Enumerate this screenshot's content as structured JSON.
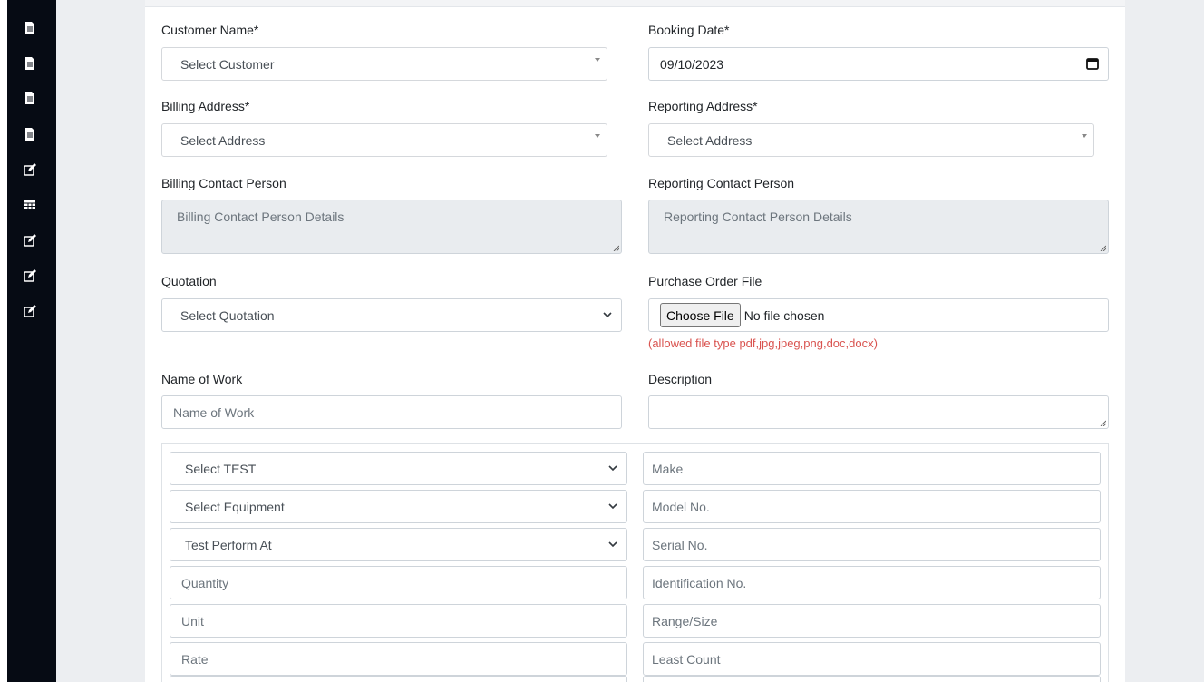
{
  "sidebar": {
    "icons": [
      "file-icon",
      "file-icon",
      "file-icon",
      "file-icon",
      "edit-icon",
      "table-icon",
      "edit-icon",
      "edit-icon",
      "edit-icon"
    ]
  },
  "form": {
    "customer_name": {
      "label": "Customer Name*",
      "value": "Select Customer"
    },
    "booking_date": {
      "label": "Booking Date*",
      "value": "09/10/2023"
    },
    "billing_address": {
      "label": "Billing Address*",
      "value": "Select Address"
    },
    "reporting_address": {
      "label": "Reporting Address*",
      "value": "Select Address"
    },
    "billing_contact": {
      "label": "Billing Contact Person",
      "value": "Billing Contact Person Details"
    },
    "reporting_contact": {
      "label": "Reporting Contact Person",
      "value": "Reporting Contact Person Details"
    },
    "quotation": {
      "label": "Quotation",
      "value": "Select Quotation"
    },
    "purchase_order": {
      "label": "Purchase Order File",
      "button": "Choose File",
      "status": "No file chosen",
      "hint": "(allowed file type pdf,jpg,jpeg,png,doc,docx)"
    },
    "name_of_work": {
      "label": "Name of Work",
      "placeholder": "Name of Work"
    },
    "description": {
      "label": "Description",
      "placeholder": ""
    }
  },
  "items": {
    "left": {
      "test": "Select TEST",
      "equipment": "Select Equipment",
      "perform_at": "Test Perform At",
      "quantity": "Quantity",
      "unit": "Unit",
      "rate": "Rate"
    },
    "right": {
      "make": "Make",
      "model": "Model No.",
      "serial": "Serial No.",
      "identification": "Identification No.",
      "range": "Range/Size",
      "least_count": "Least Count"
    }
  },
  "colors": {
    "sidebar": "#060b14",
    "background": "#eceef1",
    "hint": "#d9534f",
    "readonly": "#e9ecef"
  }
}
